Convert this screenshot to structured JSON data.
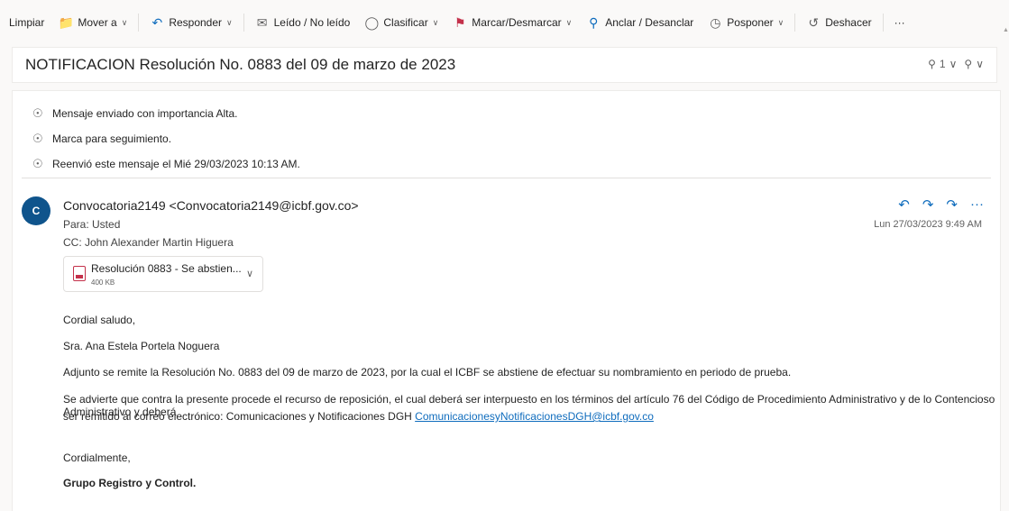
{
  "toolbar": {
    "clean": "Limpiar",
    "move": "Mover a",
    "reply": "Responder",
    "read": "Leído / No leído",
    "categorize": "Clasificar",
    "flag": "Marcar/Desmarcar",
    "pin": "Anclar / Desanclar",
    "snooze": "Posponer",
    "undo": "Deshacer",
    "more": "···"
  },
  "subject": {
    "title": "NOTIFICACION Resolución No. 0883 del 09 de marzo de 2023",
    "attachment_count": "1",
    "zoom_icon": "zoom-icon"
  },
  "info": [
    "Mensaje enviado con importancia Alta.",
    "Marca para seguimiento.",
    "Reenvió este mensaje el Mié 29/03/2023 10:13 AM."
  ],
  "message": {
    "avatar_letter": "C",
    "sender": "Convocatoria2149 <Convocatoria2149@icbf.gov.co>",
    "to": "Para: Usted",
    "cc": "CC: John Alexander Martin Higuera",
    "date": "Lun 27/03/2023 9:49 AM",
    "more": "···"
  },
  "attachment": {
    "name": "Resolución 0883 - Se abstien...",
    "size": "400 KB"
  },
  "body": {
    "greeting": "Cordial saludo,",
    "recipient": "Sra. Ana Estela Portela Noguera",
    "p1": "Adjunto se remite la Resolución No. 0883 del 09 de marzo de 2023, por la cual el ICBF se abstiene de efectuar su nombramiento en periodo de prueba.",
    "p2_a": "Se advierte que contra la presente procede el recurso de reposición, el cual deberá ser interpuesto en los términos del artículo 76 del Código de Procedimiento Administrativo y de lo Contencioso Administrativo y deberá",
    "p2_b": "ser remitido al correo electrónico: Comunicaciones y Notificaciones DGH ",
    "link": "ComunicacionesyNotificacionesDGH@icbf.gov.co",
    "closing": "Cordialmente,",
    "signature": "Grupo Registro y Control."
  }
}
